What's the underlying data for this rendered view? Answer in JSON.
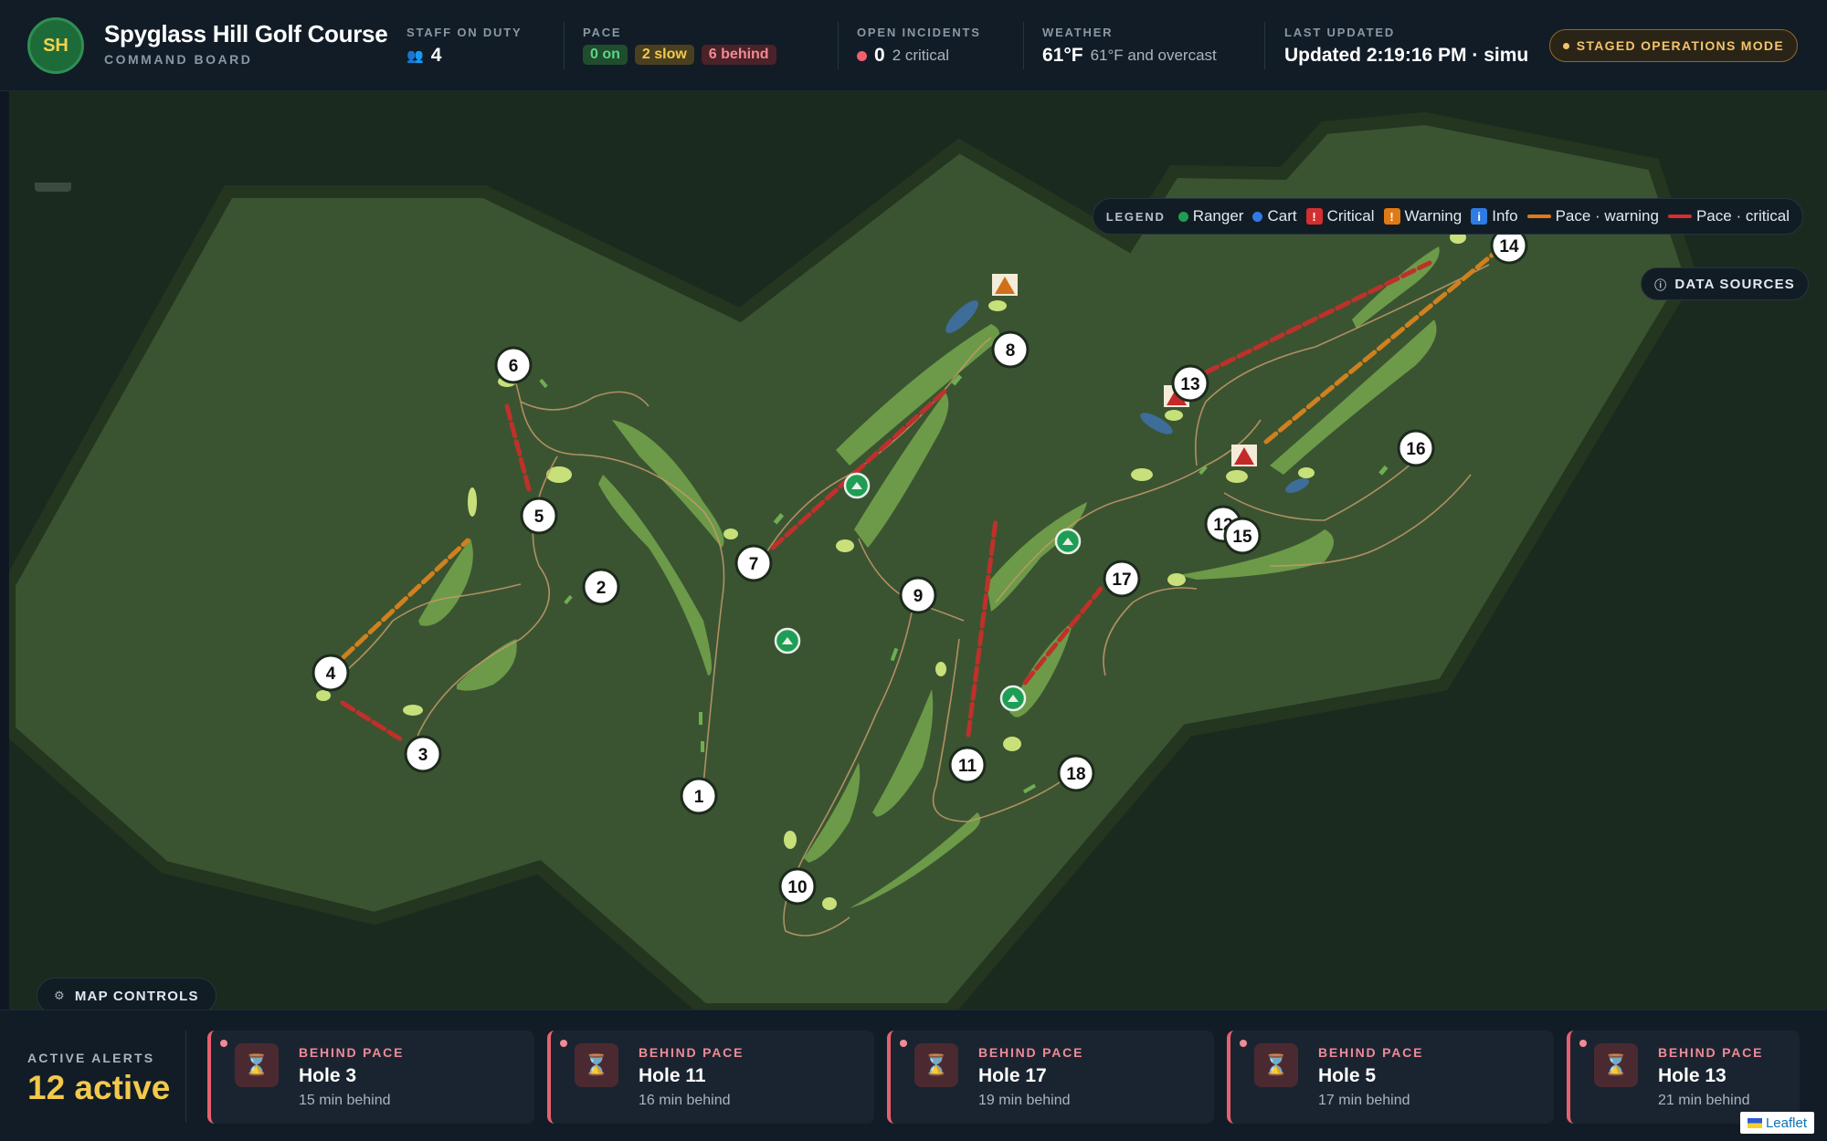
{
  "header": {
    "logo_initials": "SH",
    "title": "Spyglass Hill Golf Course",
    "subtitle": "COMMAND BOARD",
    "staff": {
      "label": "STAFF ON DUTY",
      "value": "4"
    },
    "pace": {
      "label": "PACE",
      "on": "0 on",
      "slow": "2 slow",
      "behind": "6 behind"
    },
    "incidents": {
      "label": "OPEN INCIDENTS",
      "value": "0",
      "critical": "2 critical"
    },
    "weather": {
      "label": "WEATHER",
      "temp": "61°F",
      "desc": "61°F and overcast"
    },
    "updated": {
      "label": "LAST UPDATED",
      "value": "Updated 2:19:16 PM · simu"
    },
    "mode_label": "STAGED OPERATIONS MODE"
  },
  "legend": {
    "title": "LEGEND",
    "items": [
      {
        "label": "Ranger",
        "kind": "circle",
        "color": "#1f9d55"
      },
      {
        "label": "Cart",
        "kind": "circle",
        "color": "#2f7be6"
      },
      {
        "label": "Critical",
        "kind": "square",
        "color": "#d32f2f",
        "glyph": "!"
      },
      {
        "label": "Warning",
        "kind": "square",
        "color": "#e07a16",
        "glyph": "!"
      },
      {
        "label": "Info",
        "kind": "square",
        "color": "#2f7be6",
        "glyph": "i"
      },
      {
        "label": "Pace · warning",
        "kind": "line",
        "color": "#e07a16"
      },
      {
        "label": "Pace · critical",
        "kind": "line",
        "color": "#d32f2f"
      }
    ]
  },
  "map": {
    "data_sources_label": "DATA SOURCES",
    "map_controls_label": "MAP CONTROLS",
    "holes": [
      "1",
      "2",
      "3",
      "4",
      "5",
      "6",
      "7",
      "8",
      "9",
      "10",
      "11",
      "12",
      "13",
      "14",
      "15",
      "16",
      "17",
      "18"
    ],
    "attribution": "Leaflet"
  },
  "alerts": {
    "label": "ACTIVE ALERTS",
    "count": "12 active",
    "cards": [
      {
        "type": "BEHIND PACE",
        "hole": "Hole 3",
        "detail": "15 min behind"
      },
      {
        "type": "BEHIND PACE",
        "hole": "Hole 11",
        "detail": "16 min behind"
      },
      {
        "type": "BEHIND PACE",
        "hole": "Hole 17",
        "detail": "19 min behind"
      },
      {
        "type": "BEHIND PACE",
        "hole": "Hole 5",
        "detail": "17 min behind"
      },
      {
        "type": "BEHIND PACE",
        "hole": "Hole 13",
        "detail": "21 min behind"
      }
    ]
  },
  "colors": {
    "accent_gold": "#f2c94c",
    "critical": "#d32f2f",
    "warning": "#e07a16",
    "ranger": "#1f9d55",
    "cart": "#2f7be6"
  }
}
